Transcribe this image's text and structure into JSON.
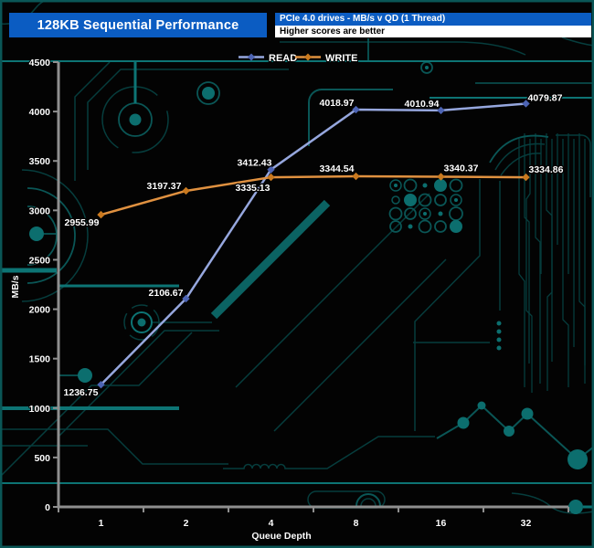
{
  "header": {
    "title": "128KB Sequential Performance",
    "subtitle": "PCIe 4.0 drives - MB/s v QD (1 Thread)",
    "note": "Higher scores are better"
  },
  "chart_data": {
    "type": "line",
    "x": [
      1,
      2,
      4,
      8,
      16,
      32
    ],
    "x_scale": "log2-categories",
    "xlabel": "Queue Depth",
    "ylabel": "MB/s",
    "ylim": [
      0,
      4500
    ],
    "ytick_step": 500,
    "grid": false,
    "legend_position": "top-center",
    "data_labels": "values shown with 2 decimals",
    "series": [
      {
        "name": "READ",
        "marker": "diamond",
        "line_color": "#96a7de",
        "marker_color": "#4d64b4",
        "values": [
          1236.75,
          2106.67,
          3412.43,
          4018.97,
          4010.94,
          4079.87
        ]
      },
      {
        "name": "WRITE",
        "marker": "diamond",
        "line_color": "#e09140",
        "marker_color": "#c9791f",
        "values": [
          2955.99,
          3197.37,
          3335.13,
          3344.54,
          3340.37,
          3334.86
        ]
      }
    ]
  },
  "colors": {
    "background": "#030303",
    "header_blue": "#0b5cc2",
    "note_bg": "#ffffff",
    "axis_gray": "#8f8f8f",
    "text_white": "#ffffff",
    "circuit_teal_bright": "#0d7474",
    "circuit_teal_mid": "#0a5656",
    "circuit_teal_dark": "#063d3d"
  }
}
